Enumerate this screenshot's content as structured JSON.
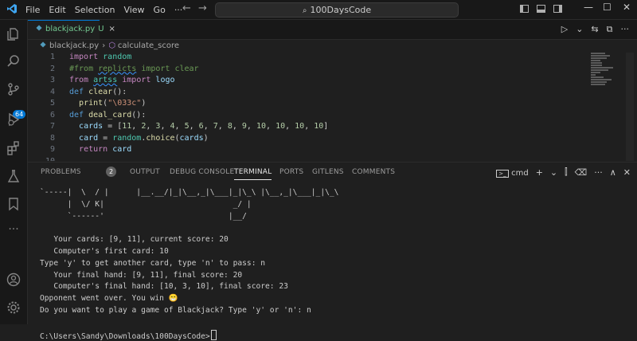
{
  "menu": [
    "File",
    "Edit",
    "Selection",
    "View",
    "Go",
    "···"
  ],
  "command_center": "100DaysCode",
  "window_controls": {
    "minimize": "—",
    "maximize": "☐",
    "close": "✕"
  },
  "activity_badge": "64",
  "tab": {
    "icon": "python-icon",
    "name": "blackjack.py",
    "status": "U",
    "close": "×"
  },
  "editor_actions": [
    "▷",
    "⌄",
    "⇆",
    "⧉",
    "···"
  ],
  "breadcrumb": {
    "file": "blackjack.py",
    "symbol": "calculate_score"
  },
  "code_lines": [
    {
      "n": "1",
      "tokens": [
        [
          "kw",
          "import"
        ],
        [
          "pl",
          " "
        ],
        [
          "mod",
          "random"
        ]
      ]
    },
    {
      "n": "2",
      "tokens": [
        [
          "cm",
          "#from "
        ],
        [
          "cmsq",
          "replicts"
        ],
        [
          "cm",
          " import clear"
        ]
      ]
    },
    {
      "n": "3",
      "tokens": [
        [
          "kw",
          "from"
        ],
        [
          "pl",
          " "
        ],
        [
          "modsq",
          "artss"
        ],
        [
          "pl",
          " "
        ],
        [
          "kw",
          "import"
        ],
        [
          "pl",
          " "
        ],
        [
          "var",
          "logo"
        ]
      ]
    },
    {
      "n": "4",
      "tokens": [
        [
          "def",
          "def"
        ],
        [
          "pl",
          " "
        ],
        [
          "fn",
          "clear"
        ],
        [
          "pl",
          "():"
        ]
      ]
    },
    {
      "n": "5",
      "tokens": [
        [
          "pl",
          "  "
        ],
        [
          "fn",
          "print"
        ],
        [
          "pl",
          "("
        ],
        [
          "str",
          "\"\\033c\""
        ],
        [
          "pl",
          ")"
        ]
      ]
    },
    {
      "n": "6",
      "tokens": [
        [
          "def",
          "def"
        ],
        [
          "pl",
          " "
        ],
        [
          "fn",
          "deal_card"
        ],
        [
          "pl",
          "():"
        ]
      ]
    },
    {
      "n": "7",
      "tokens": [
        [
          "pl",
          "  "
        ],
        [
          "var",
          "cards"
        ],
        [
          "pl",
          " = ["
        ],
        [
          "num",
          "11"
        ],
        [
          "pl",
          ", "
        ],
        [
          "num",
          "2"
        ],
        [
          "pl",
          ", "
        ],
        [
          "num",
          "3"
        ],
        [
          "pl",
          ", "
        ],
        [
          "num",
          "4"
        ],
        [
          "pl",
          ", "
        ],
        [
          "num",
          "5"
        ],
        [
          "pl",
          ", "
        ],
        [
          "num",
          "6"
        ],
        [
          "pl",
          ", "
        ],
        [
          "num",
          "7"
        ],
        [
          "pl",
          ", "
        ],
        [
          "num",
          "8"
        ],
        [
          "pl",
          ", "
        ],
        [
          "num",
          "9"
        ],
        [
          "pl",
          ", "
        ],
        [
          "num",
          "10"
        ],
        [
          "pl",
          ", "
        ],
        [
          "num",
          "10"
        ],
        [
          "pl",
          ", "
        ],
        [
          "num",
          "10"
        ],
        [
          "pl",
          ", "
        ],
        [
          "num",
          "10"
        ],
        [
          "pl",
          "]"
        ]
      ]
    },
    {
      "n": "8",
      "tokens": [
        [
          "pl",
          "  "
        ],
        [
          "var",
          "card"
        ],
        [
          "pl",
          " = "
        ],
        [
          "mod",
          "random"
        ],
        [
          "pl",
          "."
        ],
        [
          "fn",
          "choice"
        ],
        [
          "pl",
          "("
        ],
        [
          "var",
          "cards"
        ],
        [
          "pl",
          ")"
        ]
      ]
    },
    {
      "n": "9",
      "tokens": [
        [
          "pl",
          "  "
        ],
        [
          "kw",
          "return"
        ],
        [
          "pl",
          " "
        ],
        [
          "var",
          "card"
        ]
      ]
    },
    {
      "n": "10",
      "tokens": []
    }
  ],
  "panel_tabs": [
    "PROBLEMS",
    "OUTPUT",
    "DEBUG CONSOLE",
    "TERMINAL",
    "PORTS",
    "GITLENS",
    "COMMENTS"
  ],
  "problems_count": "2",
  "terminal_shell": "cmd",
  "panel_actions": [
    "+",
    "⌄",
    "⫿",
    "🗑",
    "···",
    "∧",
    "✕"
  ],
  "terminal_lines": [
    "`-----|  \\  / |      |__.__/|_|\\__,_|\\___|_|\\_\\ |\\__,_|\\___|_|\\_\\",
    "      |  \\/ K|                            _/ |",
    "      `------'                           |__/",
    "",
    "   Your cards: [9, 11], current score: 20",
    "   Computer's first card: 10",
    "Type 'y' to get another card, type 'n' to pass: n",
    "   Your final hand: [9, 11], final score: 20",
    "   Computer's final hand: [10, 3, 10], final score: 23",
    "Opponent went over. You win 😁",
    "Do you want to play a game of Blackjack? Type 'y' or 'n': n",
    "",
    "C:\\Users\\Sandy\\Downloads\\100DaysCode>"
  ]
}
